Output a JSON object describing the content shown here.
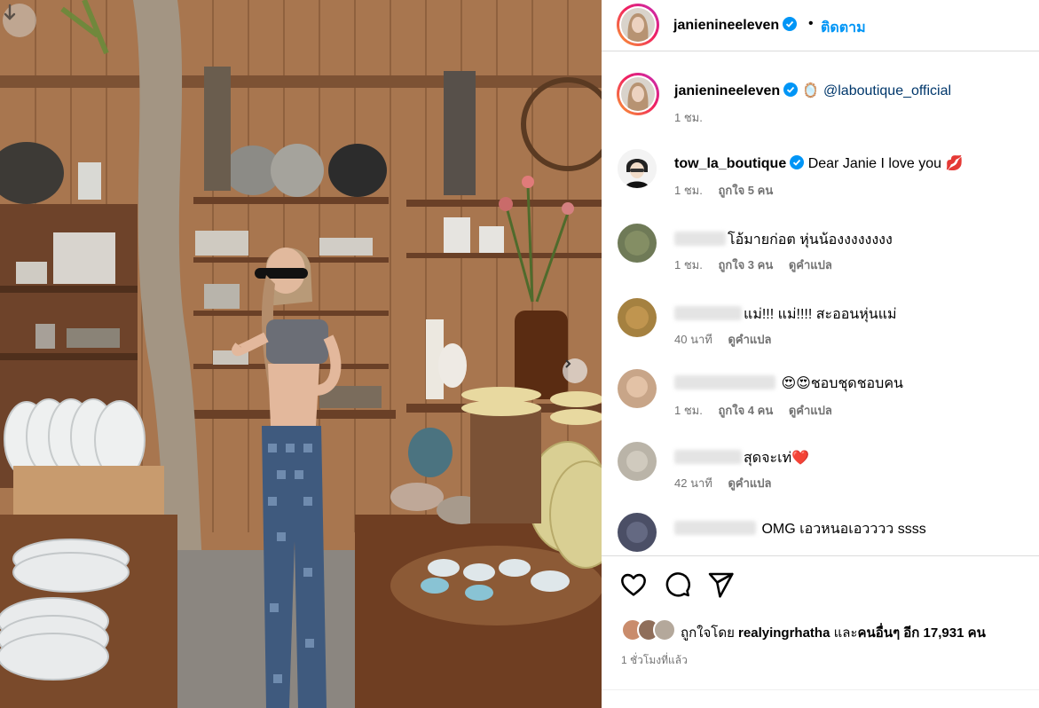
{
  "post": {
    "author": "janienineeleven",
    "follow_label": "ติดตาม",
    "dot": "•",
    "icons": {
      "verified": "verified-badge-icon",
      "photo_control": "arrow-down-icon",
      "carousel": "chevron-right-icon"
    }
  },
  "caption": {
    "username": "janienineeleven",
    "emoji": "🪞",
    "mention": "@laboutique_official",
    "time": "1 ชม."
  },
  "comments": [
    {
      "username": "tow_la_boutique",
      "text": "Dear Janie I love you 💋",
      "time": "1 ชม.",
      "likes": "ถูกใจ 5 คน",
      "translate": ""
    },
    {
      "username": "",
      "text": "โอ้มายก่อต หุ่นน้องงงงงงงง",
      "time": "1 ชม.",
      "likes": "ถูกใจ 3 คน",
      "translate": "ดูคำแปล"
    },
    {
      "username": "",
      "text": "แม่!!! แม่!!!! สะออนหุ่นแม่",
      "time": "40 นาที",
      "likes": "",
      "translate": "ดูคำแปล"
    },
    {
      "username": "",
      "text": "😍😍ชอบชุดชอบคน",
      "time": "1 ชม.",
      "likes": "ถูกใจ 4 คน",
      "translate": "ดูคำแปล"
    },
    {
      "username": "",
      "text": "สุดจะเท่❤️",
      "time": "42 นาที",
      "likes": "",
      "translate": "ดูคำแปล"
    },
    {
      "username": "",
      "text": "OMG เอวหนอเอวววว ssss",
      "time": "",
      "likes": "",
      "translate": ""
    }
  ],
  "actions": {
    "icons": [
      "heart-icon",
      "comment-icon",
      "share-icon"
    ]
  },
  "likes": {
    "prefix": "ถูกใจโดย",
    "user": "realyingrhatha",
    "joiner": "และ",
    "others": "คนอื่นๆ อีก 17,931 คน"
  },
  "timestamp": "1 ชั่วโมงที่แล้ว",
  "colors": {
    "accent": "#0095f6",
    "mention": "#00376b",
    "meta": "#737373",
    "border": "#dbdbdb",
    "verified": "#0095f6"
  }
}
